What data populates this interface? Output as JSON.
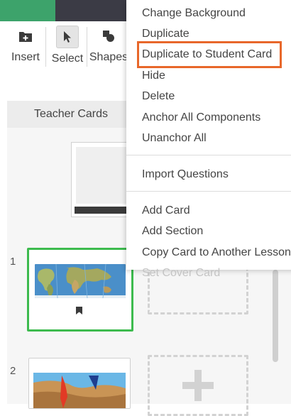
{
  "toolbar": {
    "insert_label": "Insert",
    "select_label": "Select",
    "shapes_label": "Shapes"
  },
  "panel": {
    "title": "Teacher Cards"
  },
  "cards": [
    {
      "number": "1"
    },
    {
      "number": "2"
    }
  ],
  "context_menu": {
    "items": [
      {
        "label": "Change Background"
      },
      {
        "label": "Duplicate"
      },
      {
        "label": "Duplicate to Student Card"
      },
      {
        "label": "Hide"
      },
      {
        "label": "Delete"
      },
      {
        "label": "Anchor All Components"
      },
      {
        "label": "Unanchor All"
      },
      {
        "label": "Import Questions"
      },
      {
        "label": "Add Card"
      },
      {
        "label": "Add Section"
      },
      {
        "label": "Copy Card to Another Lesson"
      },
      {
        "label": "Set Cover Card",
        "disabled": true
      }
    ],
    "highlighted_item": "Duplicate to Student Card"
  },
  "colors": {
    "accent_green": "#3dbb4e",
    "highlight_orange": "#e8672a",
    "topbar_dark": "#3b3b45"
  },
  "icons": [
    "insert-icon",
    "select-cursor-icon",
    "shapes-icon",
    "bookmark-icon",
    "plus-icon"
  ]
}
